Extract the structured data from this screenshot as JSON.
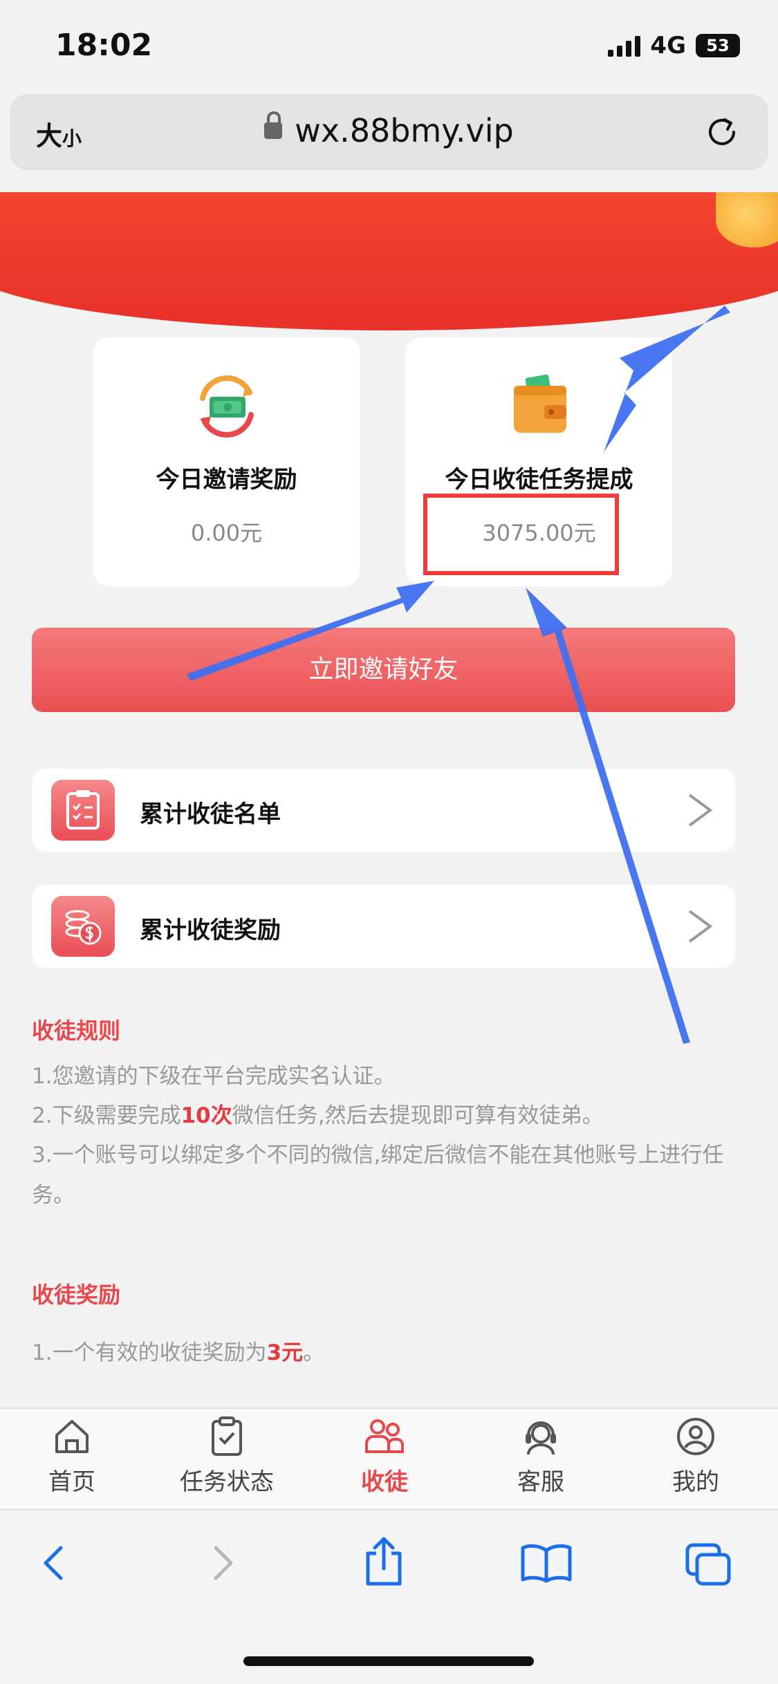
{
  "status": {
    "time": "18:02",
    "network": "4G",
    "battery": "53"
  },
  "browser": {
    "text_size_label_big": "大",
    "text_size_label_small": "小",
    "url": "wx.88bmy.vip"
  },
  "cards": [
    {
      "title": "今日邀请奖励",
      "value": "0.00元"
    },
    {
      "title": "今日收徒任务提成",
      "value": "3075.00元"
    }
  ],
  "invite_button": "立即邀请好友",
  "list": [
    {
      "label": "累计收徒名单"
    },
    {
      "label": "累计收徒奖励"
    }
  ],
  "rules": {
    "title": "收徒规则",
    "line1": "1.您邀请的下级在平台完成实名认证。",
    "line2_pre": "2.下级需要完成",
    "line2_highlight": "10次",
    "line2_post": "微信任务,然后去提现即可算有效徒弟。",
    "line3": "3.一个账号可以绑定多个不同的微信,绑定后微信不能在其他账号上进行任务。"
  },
  "rewards": {
    "title": "收徒奖励",
    "line1_pre": "1.一个有效的收徒奖励为",
    "line1_highlight": "3元",
    "line1_post": "。"
  },
  "tabs": [
    {
      "label": "首页"
    },
    {
      "label": "任务状态"
    },
    {
      "label": "收徒"
    },
    {
      "label": "客服"
    },
    {
      "label": "我的"
    }
  ],
  "colors": {
    "accent": "#e8474c",
    "banner": "#e8312a",
    "annotation_arrow": "#3f6ff0",
    "annotation_box": "#ef3b3b"
  },
  "icons": {
    "toolbar": [
      "back-icon",
      "forward-icon",
      "share-icon",
      "bookmarks-icon",
      "tabs-icon"
    ]
  }
}
